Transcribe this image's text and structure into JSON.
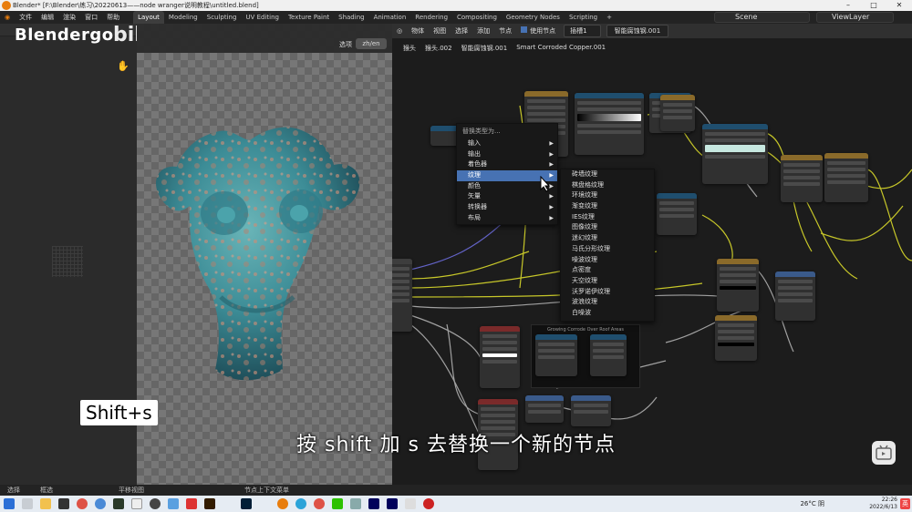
{
  "titlebar": {
    "title": "Blender* [F:\\Blender\\练习\\20220613——node wranger说明教程\\untitled.blend]",
    "minimize": "–",
    "maximize": "□",
    "close": "✕"
  },
  "menubar": {
    "file": "文件",
    "edit": "编辑",
    "render": "渲染",
    "window": "窗口",
    "help": "帮助",
    "workspaces": [
      "Layout",
      "Modeling",
      "Sculpting",
      "UV Editing",
      "Texture Paint",
      "Shading",
      "Animation",
      "Rendering",
      "Compositing",
      "Geometry Nodes",
      "Scripting"
    ],
    "active_workspace": "Layout",
    "add_workspace": "+",
    "scene": "Scene",
    "view_layer": "ViewLayer"
  },
  "watermark": {
    "logo": "Blendergo",
    "bili": "bilibili"
  },
  "viewport": {
    "select_label": "选项",
    "lang_button": "zh/en"
  },
  "node_editor": {
    "header": {
      "object": "物体",
      "view": "视图",
      "select": "选择",
      "add": "添加",
      "node": "节点",
      "use_nodes": "使用节点",
      "slot": "插槽1",
      "material": "智能腐蚀钢.001"
    },
    "breadcrumb": {
      "object": "猴头",
      "mesh": "猴头.002",
      "material": "智能腐蚀钢.001",
      "group": "Smart Corroded Copper.001"
    },
    "frame_label": "Growing Corrode Over Roof Areas"
  },
  "context_menu": {
    "title": "替换类型为...",
    "items": [
      {
        "label": "输入",
        "highlight": false
      },
      {
        "label": "输出",
        "highlight": false
      },
      {
        "label": "着色器",
        "highlight": false
      },
      {
        "label": "纹理",
        "highlight": true
      },
      {
        "label": "颜色",
        "highlight": false
      },
      {
        "label": "矢量",
        "highlight": false
      },
      {
        "label": "转换器",
        "highlight": false
      },
      {
        "label": "布局",
        "highlight": false
      }
    ]
  },
  "texture_submenu": {
    "items": [
      "砖墙纹理",
      "棋盘格纹理",
      "环境纹理",
      "渐变纹理",
      "IES纹理",
      "图像纹理",
      "迷幻纹理",
      "马氏分形纹理",
      "噪波纹理",
      "点密度",
      "天空纹理",
      "沃罗诺伊纹理",
      "波浪纹理",
      "白噪波"
    ]
  },
  "overlay": {
    "shortcut": "Shift+s",
    "caption": "按 shift 加 s 去替换一个新的节点"
  },
  "statusbar": {
    "select": "选择",
    "box_select": "框选",
    "pan_view": "平移视图",
    "node_context": "节点上下文菜单"
  },
  "taskbar": {
    "temperature": "26°C 阴",
    "time": "22:26",
    "date": "2022/6/13",
    "ime": "英"
  },
  "colors": {
    "accent_blue": "#4772b3",
    "node_texture": "#8a6a2a",
    "node_color": "#1f4e6e",
    "node_input": "#7a2a2a",
    "node_converter": "#3a5a8a"
  }
}
